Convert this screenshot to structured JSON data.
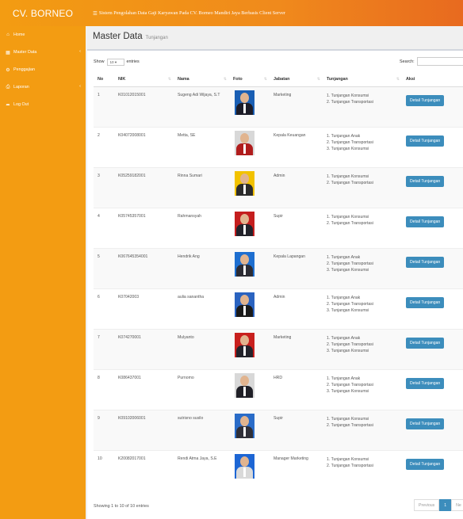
{
  "brand": "CV. BORNEO",
  "system_title": "Sistem Pengolahan Data Gaji Karyawan Pada CV. Borneo Mandiri Jaya Berbasis Client Server",
  "sidebar": [
    {
      "label": "Home",
      "icon": "home-icon",
      "glyph": "⌂",
      "chevron": false
    },
    {
      "label": "Master Data",
      "icon": "table-icon",
      "glyph": "▦",
      "chevron": true
    },
    {
      "label": "Penggajian",
      "icon": "gear-icon",
      "glyph": "⚙",
      "chevron": false
    },
    {
      "label": "Laporan",
      "icon": "print-icon",
      "glyph": "⎙",
      "chevron": true
    },
    {
      "label": "Log Out",
      "icon": "sign-out-icon",
      "glyph": "➦",
      "chevron": false
    }
  ],
  "page": {
    "title": "Master Data",
    "subtitle": "Tunjangan"
  },
  "controls": {
    "show_label": "Show",
    "show_value": "10",
    "entries_label": "entries",
    "search_label": "Search:"
  },
  "table": {
    "columns": [
      "No",
      "NIK",
      "Nama",
      "Foto",
      "Jabatan",
      "Tunjangan",
      "Aksi"
    ],
    "rows": [
      {
        "no": "1",
        "nik": "K01012015001",
        "nama": "Sugeng Adi Wijaya, S.T",
        "jabatan": "Marketing",
        "tunjangan": [
          "1. Tunjangan Konsumsi",
          "2. Tunjangan Transportasi"
        ],
        "aksi": "Detail Tunjangan",
        "photo_bg": "#1a5fb4",
        "photo_body": "#1c1c28"
      },
      {
        "no": "2",
        "nik": "K04072008001",
        "nama": "Metta, SE",
        "jabatan": "Kepala Keuangan",
        "tunjangan": [
          "1. Tunjangan Anak",
          "2. Tunjangan Transportasi",
          "3. Tunjangan Konsumsi"
        ],
        "aksi": "Detail Tunjangan",
        "photo_bg": "#d8d8d8",
        "photo_body": "#b01c1c"
      },
      {
        "no": "3",
        "nik": "K05259182001",
        "nama": "Rinna Sumari",
        "jabatan": "Admin",
        "tunjangan": [
          "1. Tunjangan Konsumsi",
          "2. Tunjangan Transportasi"
        ],
        "aksi": "Detail Tunjangan",
        "photo_bg": "#f2c200",
        "photo_body": "#2b2b2b"
      },
      {
        "no": "4",
        "nik": "K05745357001",
        "nama": "Rahmansyah",
        "jabatan": "Supir",
        "tunjangan": [
          "1. Tunjangan Konsumsi",
          "2. Tunjangan Transportasi"
        ],
        "aksi": "Detail Tunjangan",
        "photo_bg": "#c41e1e",
        "photo_body": "#22222a"
      },
      {
        "no": "5",
        "nik": "K067645354001",
        "nama": "Hendrik Ang",
        "jabatan": "Kepala Lapangan",
        "tunjangan": [
          "1. Tunjangan Anak",
          "2. Tunjangan Transportasi",
          "3. Tunjangan Konsumsi"
        ],
        "aksi": "Detail Tunjangan",
        "photo_bg": "#1e6fd0",
        "photo_body": "#2c2c34"
      },
      {
        "no": "6",
        "nik": "K07042003",
        "nama": "aulia sanantha",
        "jabatan": "Admin",
        "tunjangan": [
          "1. Tunjangan Anak",
          "2. Tunjangan Transportasi",
          "3. Tunjangan Konsumsi"
        ],
        "aksi": "Detail Tunjangan",
        "photo_bg": "#2a63c0",
        "photo_body": "#1a1a1a"
      },
      {
        "no": "7",
        "nik": "K074270001",
        "nama": "Mulyanto",
        "jabatan": "Marketing",
        "tunjangan": [
          "1. Tunjangan Anak",
          "2. Tunjangan Transportasi",
          "3. Tunjangan Konsumsi"
        ],
        "aksi": "Detail Tunjangan",
        "photo_bg": "#c8201e",
        "photo_body": "#23232b"
      },
      {
        "no": "8",
        "nik": "K086437001",
        "nama": "Purnomo",
        "jabatan": "HRD",
        "tunjangan": [
          "1. Tunjangan Anak",
          "2. Tunjangan Transportasi",
          "3. Tunjangan Konsumsi"
        ],
        "aksi": "Detail Tunjangan",
        "photo_bg": "#d8d8d8",
        "photo_body": "#1f1f26"
      },
      {
        "no": "9",
        "nik": "K09102006001",
        "nama": "sutrisno susilo",
        "jabatan": "Supir",
        "tunjangan": [
          "1. Tunjangan Konsumsi",
          "2. Tunjangan Transportasi"
        ],
        "aksi": "Detail Tunjangan",
        "photo_bg": "#2a6cc8",
        "photo_body": "#2f2f38"
      },
      {
        "no": "10",
        "nik": "K20082017001",
        "nama": "Rendi Atma Jaya, S.E",
        "jabatan": "Manager Marketing",
        "tunjangan": [
          "1. Tunjangan Konsumsi",
          "2. Tunjangan Transportasi"
        ],
        "aksi": "Detail Tunjangan",
        "photo_bg": "#1d66d4",
        "photo_body": "#d9d9d9"
      }
    ]
  },
  "footer": {
    "info": "Showing 1 to 10 of 10 entries",
    "prev": "Previous",
    "page": "1",
    "next": "Ne"
  }
}
